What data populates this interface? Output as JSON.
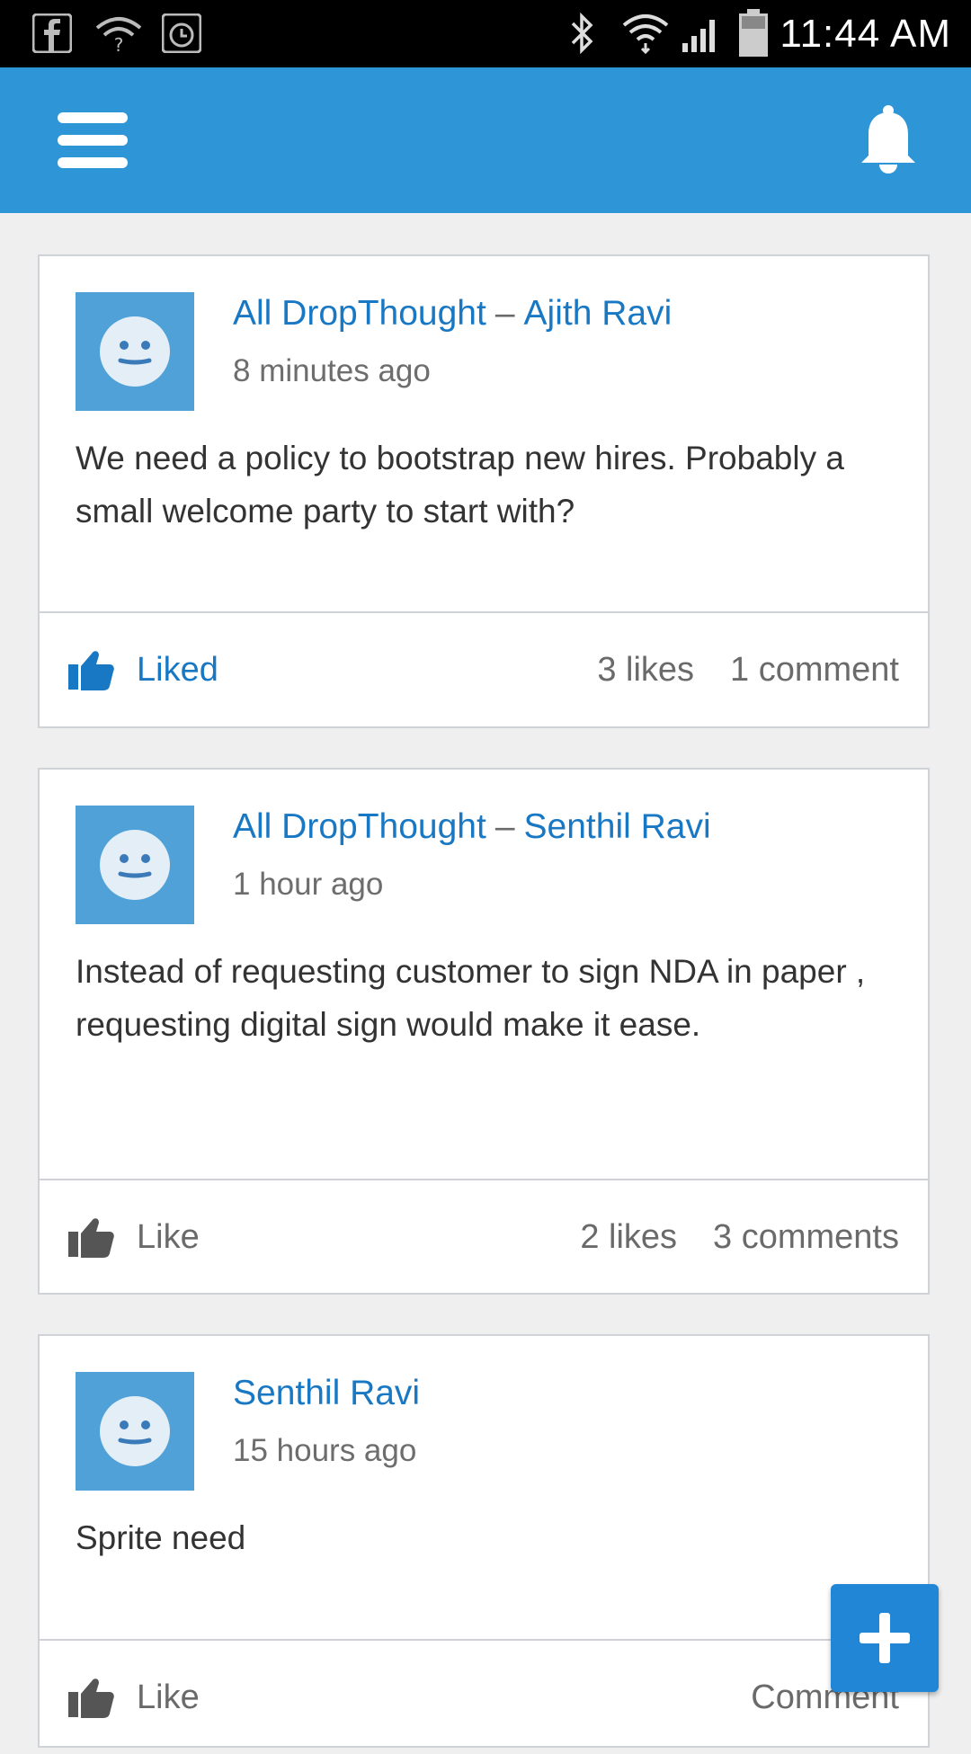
{
  "status_bar": {
    "time": "11:44 AM",
    "icons": [
      "facebook-icon",
      "wifi-question-icon",
      "alarm-icon",
      "bluetooth-icon",
      "wifi-icon",
      "signal-icon",
      "battery-icon"
    ]
  },
  "app_bar": {
    "menu_icon": "hamburger-menu-icon",
    "notification_icon": "bell-icon",
    "color": "#2e95d6"
  },
  "posts": [
    {
      "group": "All DropThought",
      "separator": "–",
      "author": "Ajith Ravi",
      "time": "8 minutes ago",
      "text": "We need a policy to bootstrap new hires. Probably a small welcome party to start with?",
      "like_label": "Liked",
      "liked": true,
      "likes": "3 likes",
      "comments": "1 comment"
    },
    {
      "group": "All DropThought",
      "separator": "–",
      "author": "Senthil Ravi",
      "time": "1 hour ago",
      "text": "Instead of requesting customer to sign NDA in paper , requesting digital sign would make it ease.",
      "like_label": "Like",
      "liked": false,
      "likes": "2 likes",
      "comments": "3 comments"
    },
    {
      "group": "",
      "separator": "",
      "author": "Senthil Ravi",
      "time": "15 hours ago",
      "text": "Sprite need",
      "like_label": "Like",
      "liked": false,
      "likes": "",
      "comments": "Comment"
    }
  ],
  "fab": {
    "icon": "plus-icon"
  },
  "colors": {
    "accent": "#1878c4",
    "muted": "#6a6a6a",
    "avatar": "#4fa1d8"
  }
}
